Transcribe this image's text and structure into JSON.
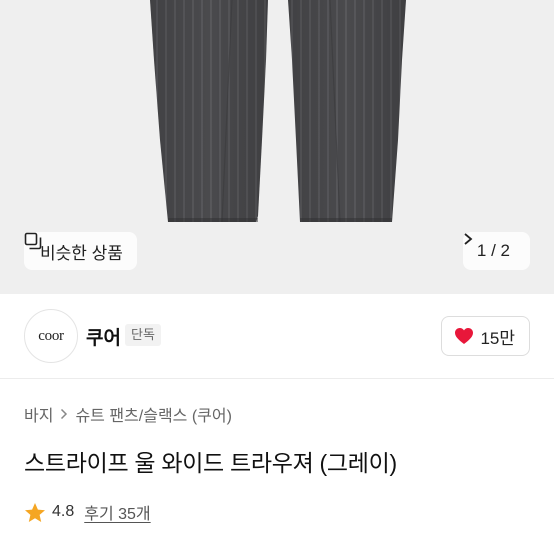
{
  "gallery": {
    "similar_label": "비슷한 상품",
    "page_indicator": "1 / 2"
  },
  "brand": {
    "logo_text": "coor",
    "name": "쿠어",
    "badge": "단독"
  },
  "likes": {
    "count": "15만",
    "heart_color": "#e8173a"
  },
  "breadcrumb": {
    "level1": "바지",
    "level2": "슈트 팬츠/슬랙스 (쿠어)"
  },
  "product": {
    "title": "스트라이프 울 와이드 트라우져 (그레이)"
  },
  "rating": {
    "score": "4.8",
    "reviews": "후기 35개",
    "star_color": "#f5a623"
  }
}
